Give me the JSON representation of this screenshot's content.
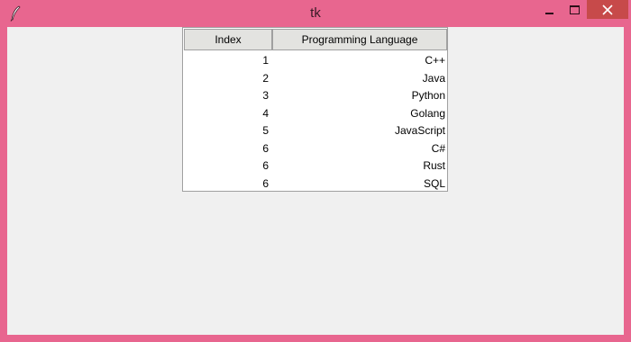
{
  "window": {
    "title": "tk"
  },
  "table": {
    "columns": [
      "Index",
      "Programming Language"
    ],
    "rows": [
      {
        "index": "1",
        "language": "C++"
      },
      {
        "index": "2",
        "language": "Java"
      },
      {
        "index": "3",
        "language": "Python"
      },
      {
        "index": "4",
        "language": "Golang"
      },
      {
        "index": "5",
        "language": "JavaScript"
      },
      {
        "index": "6",
        "language": "C#"
      },
      {
        "index": "6",
        "language": "Rust"
      },
      {
        "index": "6",
        "language": "SQL"
      }
    ]
  }
}
